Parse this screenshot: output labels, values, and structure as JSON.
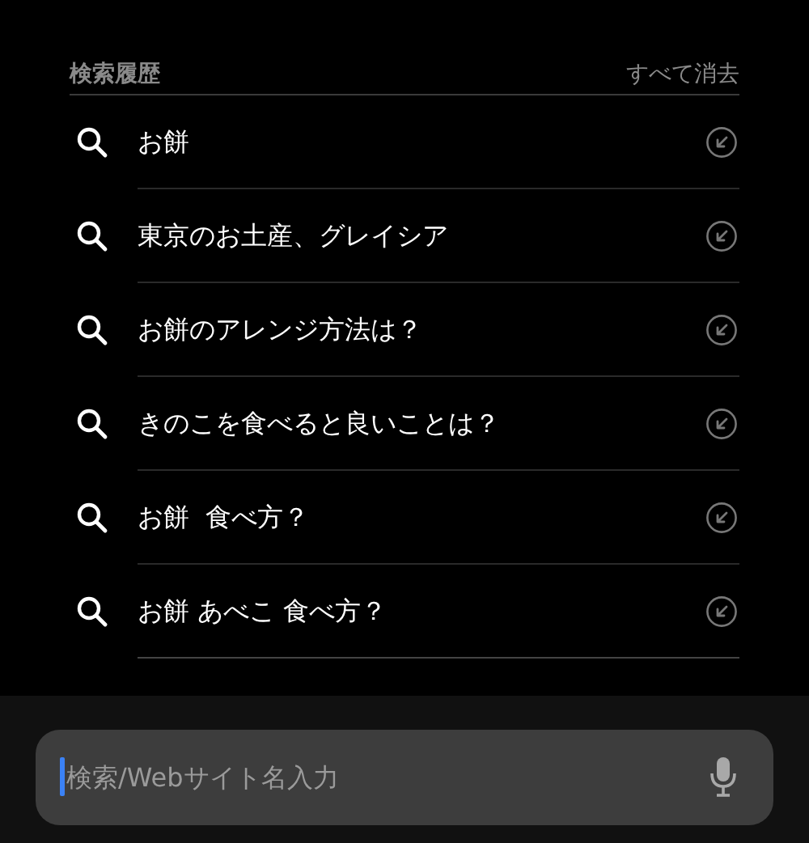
{
  "history": {
    "title": "検索履歴",
    "clear_all": "すべて消去",
    "items": [
      {
        "query": "お餅"
      },
      {
        "query": "東京のお土産、グレイシア"
      },
      {
        "query": "お餅のアレンジ方法は？"
      },
      {
        "query": "きのこを食べると良いことは？"
      },
      {
        "query": "お餅  食べ方？"
      },
      {
        "query": "お餅 あべこ 食べ方？"
      }
    ]
  },
  "search": {
    "placeholder": "検索/Webサイト名入力"
  }
}
